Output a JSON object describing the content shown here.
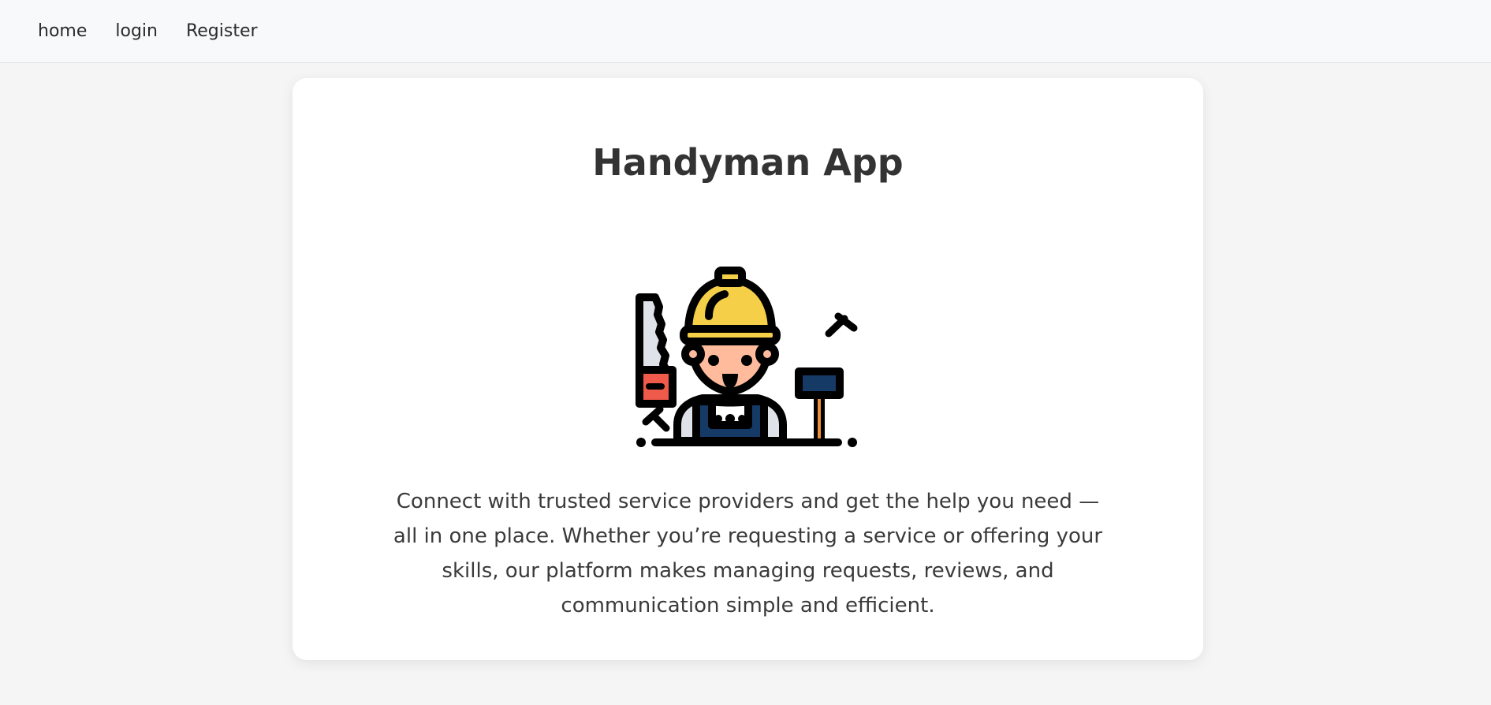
{
  "nav": {
    "links": [
      {
        "label": "home"
      },
      {
        "label": "login"
      },
      {
        "label": "Register"
      }
    ]
  },
  "hero": {
    "title": "Handyman App",
    "illustration_icon": "handyman-worker-icon",
    "description": "Connect with trusted service providers and get the help you need — all in one place. Whether you’re requesting a service or offering your skills, our platform makes managing requests, reviews, and communication simple and efficient."
  },
  "colors": {
    "background": "#f5f5f5",
    "navbar": "#f8f9fa",
    "card": "#ffffff",
    "helmet": "#f6cf48",
    "skin": "#ffbb9c",
    "overalls": "#153a66",
    "saw_handle": "#ef5a4a",
    "saw_blade": "#dfe2e8"
  }
}
